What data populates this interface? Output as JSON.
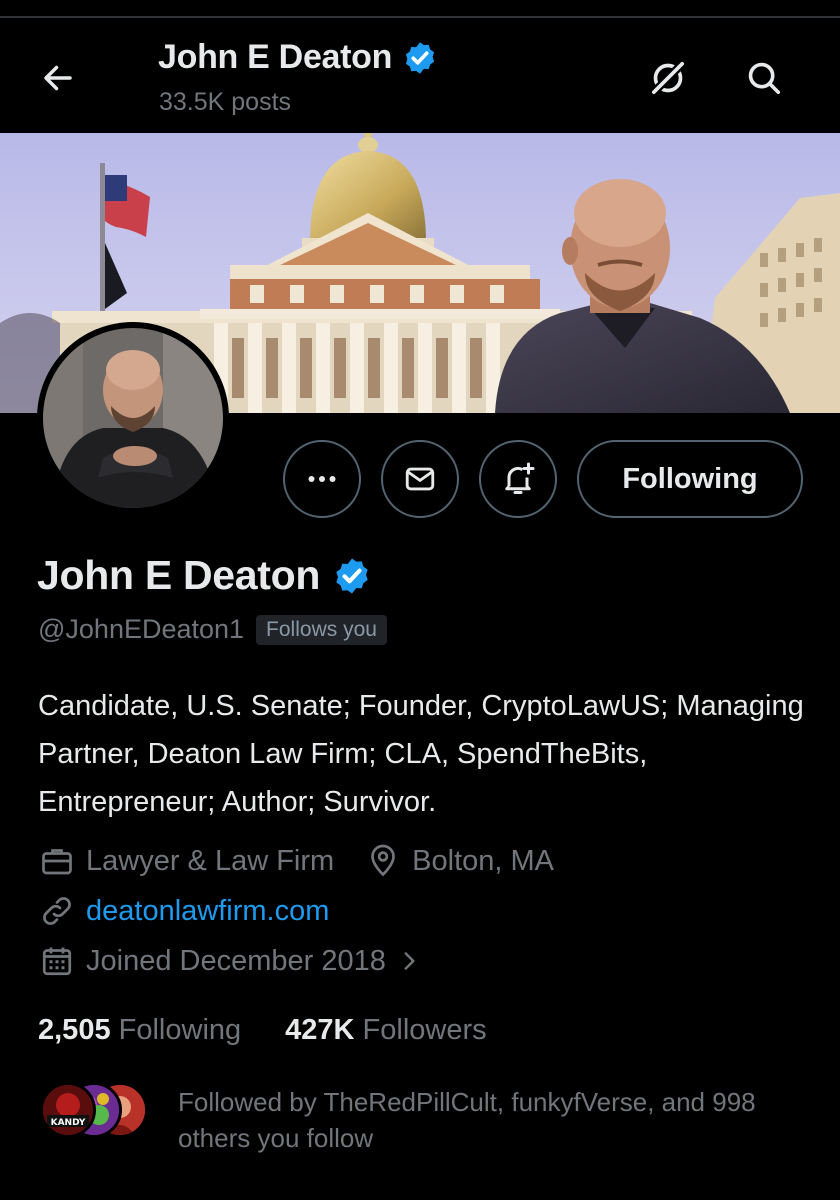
{
  "header": {
    "title": "John E Deaton",
    "posts": "33.5K posts"
  },
  "profile": {
    "name": "John E Deaton",
    "handle": "@JohnEDeaton1",
    "follows_you": "Follows you",
    "bio": "Candidate, U.S. Senate; Founder, CryptoLawUS; Managing Partner, Deaton Law Firm; CLA, SpendTheBits, Entrepreneur; Author; Survivor.",
    "category": "Lawyer & Law Firm",
    "location": "Bolton, MA",
    "website": "deatonlawfirm.com",
    "joined": "Joined December 2018"
  },
  "actions": {
    "following_label": "Following"
  },
  "stats": {
    "following_count": "2,505",
    "following_label": "Following",
    "followers_count": "427K",
    "followers_label": "Followers"
  },
  "followed_by": {
    "text": "Followed by TheRedPillCult, funkyfVerse, and 998 others you follow",
    "avatar_label": "KANDY"
  },
  "colors": {
    "accent": "#1d9bf0",
    "background": "#000000",
    "text": "#e7e9ea",
    "secondary_text": "#71767b"
  },
  "icons": [
    "back-arrow-icon",
    "grok-icon",
    "search-icon",
    "more-icon",
    "mail-icon",
    "notification-bell-icon",
    "verified-badge-icon",
    "briefcase-icon",
    "location-pin-icon",
    "link-icon",
    "calendar-icon",
    "chevron-right-icon"
  ]
}
